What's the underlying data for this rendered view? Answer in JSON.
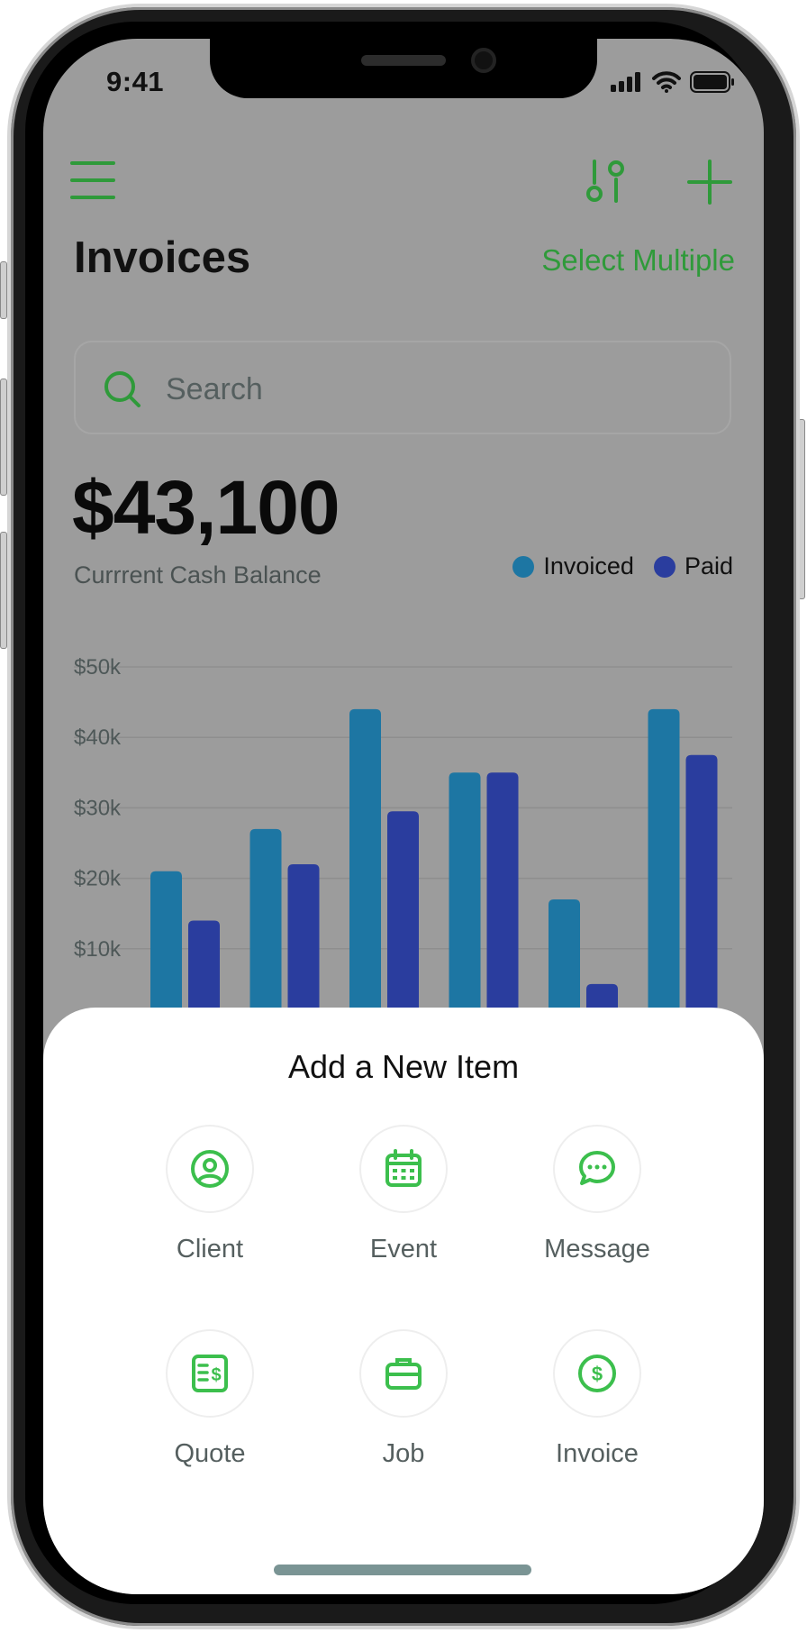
{
  "status_bar": {
    "time": "9:41"
  },
  "header": {
    "title": "Invoices",
    "select_multiple": "Select Multiple"
  },
  "search": {
    "placeholder": "Search"
  },
  "balance": {
    "amount": "$43,100",
    "label": "Currrent Cash Balance"
  },
  "legend": [
    {
      "label": "Invoiced",
      "color": "#1d76a3"
    },
    {
      "label": "Paid",
      "color": "#2a3d9e"
    }
  ],
  "chart_data": {
    "type": "bar",
    "y_tick_labels": [
      "$50k",
      "$40k",
      "$30k",
      "$20k",
      "$10k"
    ],
    "ylim": [
      0,
      50000
    ],
    "series": [
      {
        "name": "Invoiced",
        "color": "#1d76a3",
        "values": [
          21000,
          27000,
          44000,
          35000,
          17000,
          44000
        ]
      },
      {
        "name": "Paid",
        "color": "#2a3d9e",
        "values": [
          14000,
          22000,
          29500,
          35000,
          5000,
          37500
        ]
      }
    ]
  },
  "sheet": {
    "title": "Add a New Item",
    "items": [
      {
        "label": "Client",
        "icon": "user-circle-icon"
      },
      {
        "label": "Event",
        "icon": "calendar-icon"
      },
      {
        "label": "Message",
        "icon": "chat-bubble-icon"
      },
      {
        "label": "Quote",
        "icon": "quote-document-icon"
      },
      {
        "label": "Job",
        "icon": "briefcase-icon"
      },
      {
        "label": "Invoice",
        "icon": "dollar-circle-icon"
      }
    ]
  },
  "colors": {
    "accent": "#2f9a3a",
    "icon_green": "#3cbf4d"
  }
}
